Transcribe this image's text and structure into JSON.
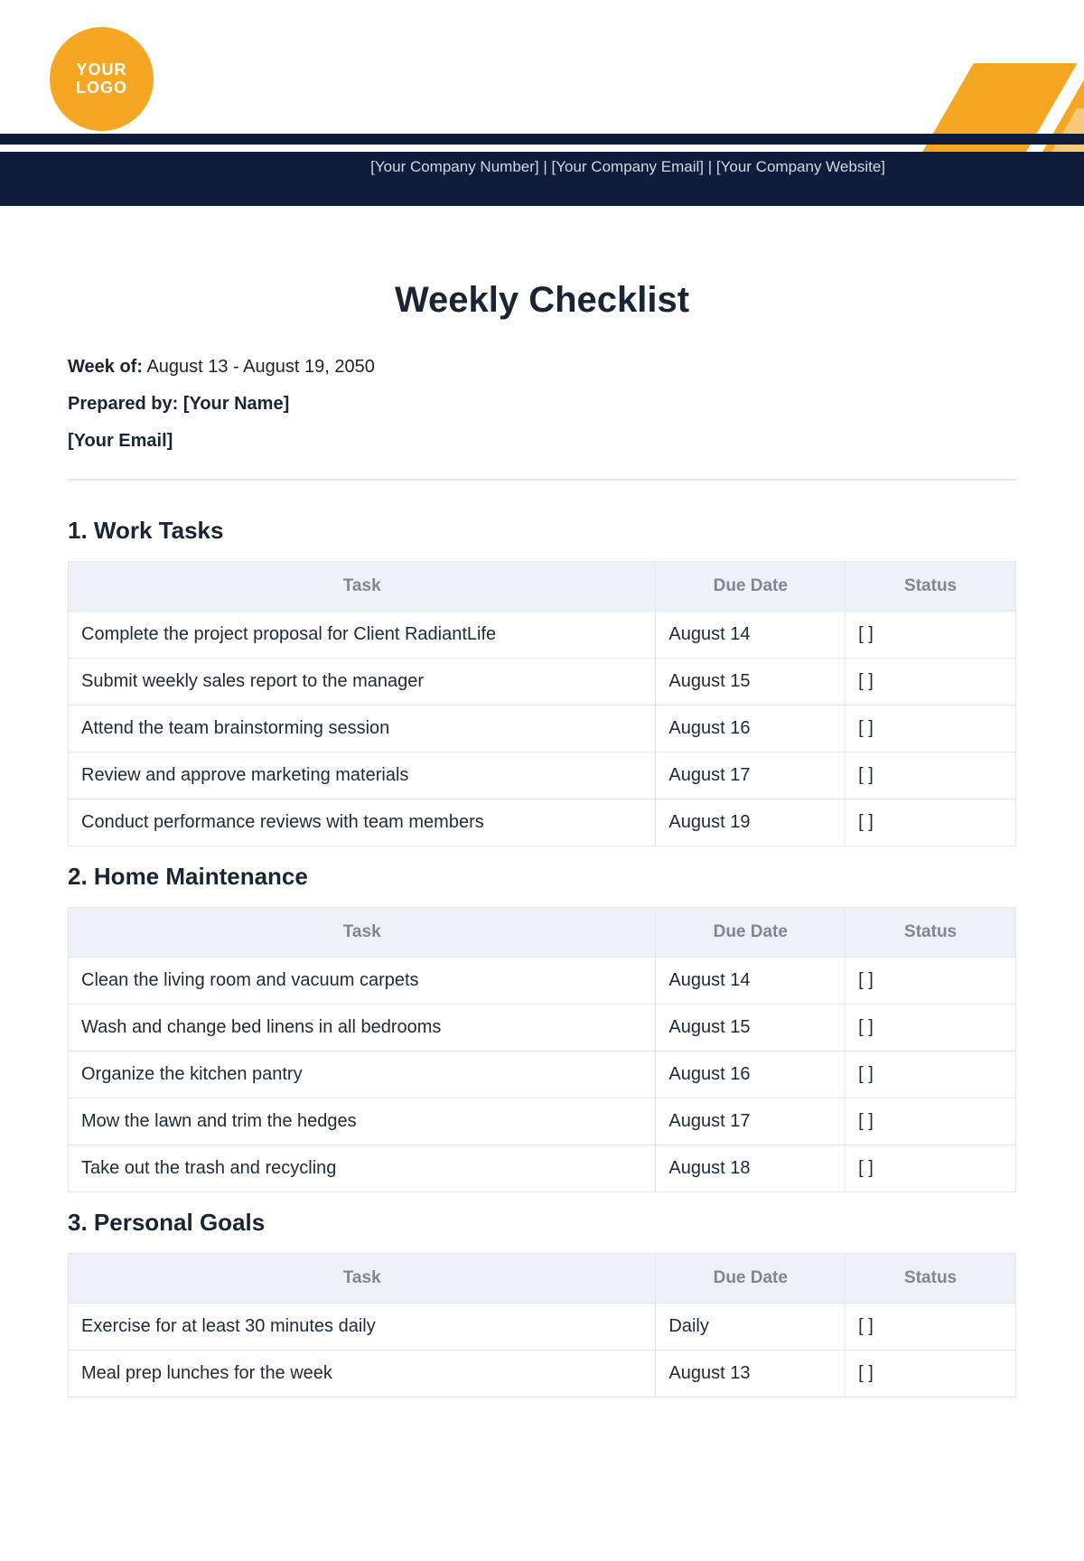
{
  "logo": {
    "line1": "YOUR",
    "line2": "LOGO"
  },
  "header": {
    "company_number": "[Your Company Number]",
    "company_email": "[Your Company Email]",
    "company_website": "[Your Company Website]",
    "separator": "  |  "
  },
  "title": "Weekly Checklist",
  "meta": {
    "week_label": "Week of:",
    "week_value": "August 13 - August 19, 2050",
    "prepared_label": "Prepared by:",
    "prepared_value": "[Your Name]",
    "email_value": "[Your Email]"
  },
  "columns": {
    "task": "Task",
    "due": "Due Date",
    "status": "Status"
  },
  "sections": [
    {
      "heading": "1. Work Tasks",
      "rows": [
        {
          "task": "Complete the project proposal for Client RadiantLife",
          "due": "August 14",
          "status": "[ ]"
        },
        {
          "task": "Submit weekly sales report to the manager",
          "due": "August 15",
          "status": "[ ]"
        },
        {
          "task": "Attend the team brainstorming session",
          "due": "August 16",
          "status": "[ ]"
        },
        {
          "task": "Review and approve marketing materials",
          "due": "August 17",
          "status": "[ ]"
        },
        {
          "task": "Conduct performance reviews with team members",
          "due": "August 19",
          "status": "[ ]"
        }
      ]
    },
    {
      "heading": "2. Home Maintenance",
      "rows": [
        {
          "task": "Clean the living room and vacuum carpets",
          "due": "August 14",
          "status": "[ ]"
        },
        {
          "task": "Wash and change bed linens in all bedrooms",
          "due": "August 15",
          "status": "[ ]"
        },
        {
          "task": "Organize the kitchen pantry",
          "due": "August 16",
          "status": "[ ]"
        },
        {
          "task": "Mow the lawn and trim the hedges",
          "due": "August 17",
          "status": "[ ]"
        },
        {
          "task": "Take out the trash and recycling",
          "due": "August 18",
          "status": "[ ]"
        }
      ]
    },
    {
      "heading": "3. Personal Goals",
      "rows": [
        {
          "task": "Exercise for at least 30 minutes daily",
          "due": "Daily",
          "status": "[ ]"
        },
        {
          "task": "Meal prep lunches for the week",
          "due": "August 13",
          "status": "[ ]"
        }
      ]
    }
  ]
}
